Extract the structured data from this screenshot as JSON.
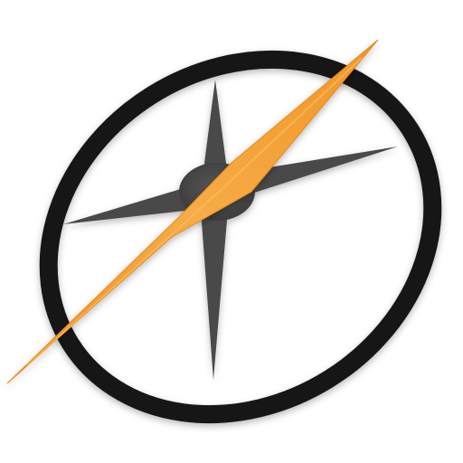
{
  "icon": {
    "name": "compass-icon",
    "colors": {
      "background": "#ffffff",
      "ring": "#151515",
      "star_points": "#4a4a4a",
      "needle": "#f39a2c",
      "needle_highlight": "#f7b24f"
    }
  }
}
